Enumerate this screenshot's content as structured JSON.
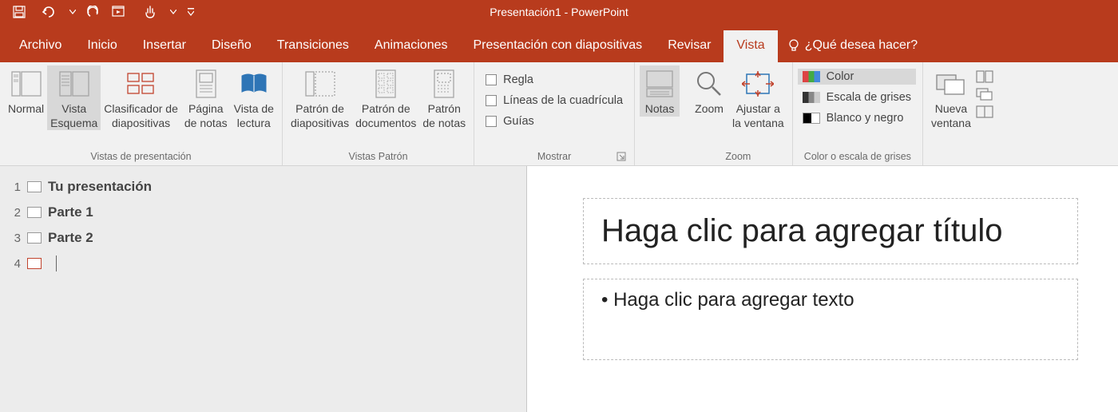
{
  "window": {
    "title": "Presentación1 - PowerPoint"
  },
  "tabs": {
    "archivo": "Archivo",
    "inicio": "Inicio",
    "insertar": "Insertar",
    "diseno": "Diseño",
    "transiciones": "Transiciones",
    "animaciones": "Animaciones",
    "presentacion": "Presentación con diapositivas",
    "revisar": "Revisar",
    "vista": "Vista",
    "tellme": "¿Qué desea hacer?"
  },
  "ribbon": {
    "vistas_presentacion": {
      "label": "Vistas de presentación",
      "normal": "Normal",
      "esquema_l1": "Vista",
      "esquema_l2": "Esquema",
      "clasificador_l1": "Clasificador de",
      "clasificador_l2": "diapositivas",
      "pagina_notas_l1": "Página",
      "pagina_notas_l2": "de notas",
      "vista_lectura_l1": "Vista de",
      "vista_lectura_l2": "lectura"
    },
    "vistas_patron": {
      "label": "Vistas Patrón",
      "diapositivas_l1": "Patrón de",
      "diapositivas_l2": "diapositivas",
      "documentos_l1": "Patrón de",
      "documentos_l2": "documentos",
      "notas_l1": "Patrón",
      "notas_l2": "de notas"
    },
    "mostrar": {
      "label": "Mostrar",
      "regla": "Regla",
      "cuadricula": "Líneas de la cuadrícula",
      "guias": "Guías"
    },
    "notas": {
      "label": "Notas"
    },
    "zoom": {
      "label": "Zoom",
      "zoom": "Zoom",
      "ajustar_l1": "Ajustar a",
      "ajustar_l2": "la ventana"
    },
    "color": {
      "label": "Color o escala de grises",
      "color": "Color",
      "grises": "Escala de grises",
      "bn": "Blanco y negro"
    },
    "ventana": {
      "nueva_l1": "Nueva",
      "nueva_l2": "ventana"
    }
  },
  "outline": {
    "items": [
      {
        "num": "1",
        "title": "Tu presentación"
      },
      {
        "num": "2",
        "title": "Parte 1"
      },
      {
        "num": "3",
        "title": "Parte 2"
      },
      {
        "num": "4",
        "title": ""
      }
    ]
  },
  "slide": {
    "title_placeholder": "Haga clic para agregar título",
    "body_placeholder": "• Haga clic para agregar texto"
  }
}
